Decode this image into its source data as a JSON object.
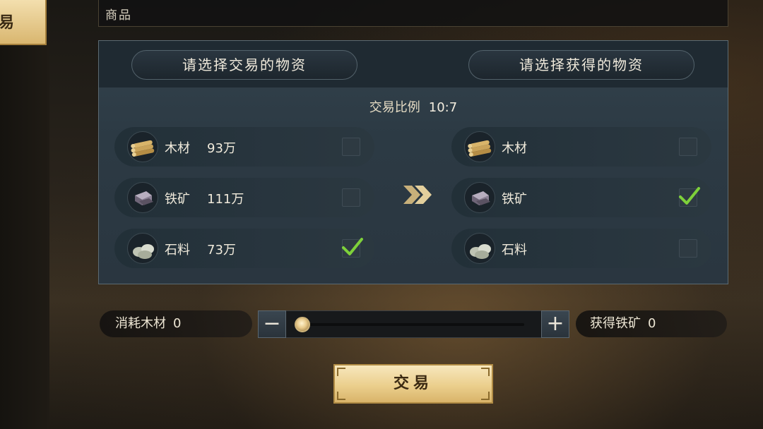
{
  "side_tab": {
    "label": "易"
  },
  "goods_bar": {
    "label": "商品"
  },
  "panel": {
    "left_header": "请选择交易的物资",
    "right_header": "请选择获得的物资",
    "ratio_label": "交易比例",
    "ratio_value": "10:7",
    "give_items": [
      {
        "icon": "wood-icon",
        "name": "木材",
        "amount": "93万",
        "checked": false
      },
      {
        "icon": "iron-ore-icon",
        "name": "铁矿",
        "amount": "111万",
        "checked": false
      },
      {
        "icon": "stone-icon",
        "name": "石料",
        "amount": "73万",
        "checked": true
      }
    ],
    "get_items": [
      {
        "icon": "wood-icon",
        "name": "木材",
        "checked": false
      },
      {
        "icon": "iron-ore-icon",
        "name": "铁矿",
        "checked": true
      },
      {
        "icon": "stone-icon",
        "name": "石料",
        "checked": false
      }
    ]
  },
  "controls": {
    "consume_label": "消耗木材",
    "consume_value": "0",
    "gain_label": "获得铁矿",
    "gain_value": "0",
    "minus": "−",
    "plus": "+",
    "slider_fraction": 0
  },
  "trade_button": {
    "label": "交易"
  },
  "colors": {
    "accent_gold": "#ebcf8d",
    "check_green": "#7ed13a",
    "panel_bg": "#2c3a44"
  }
}
